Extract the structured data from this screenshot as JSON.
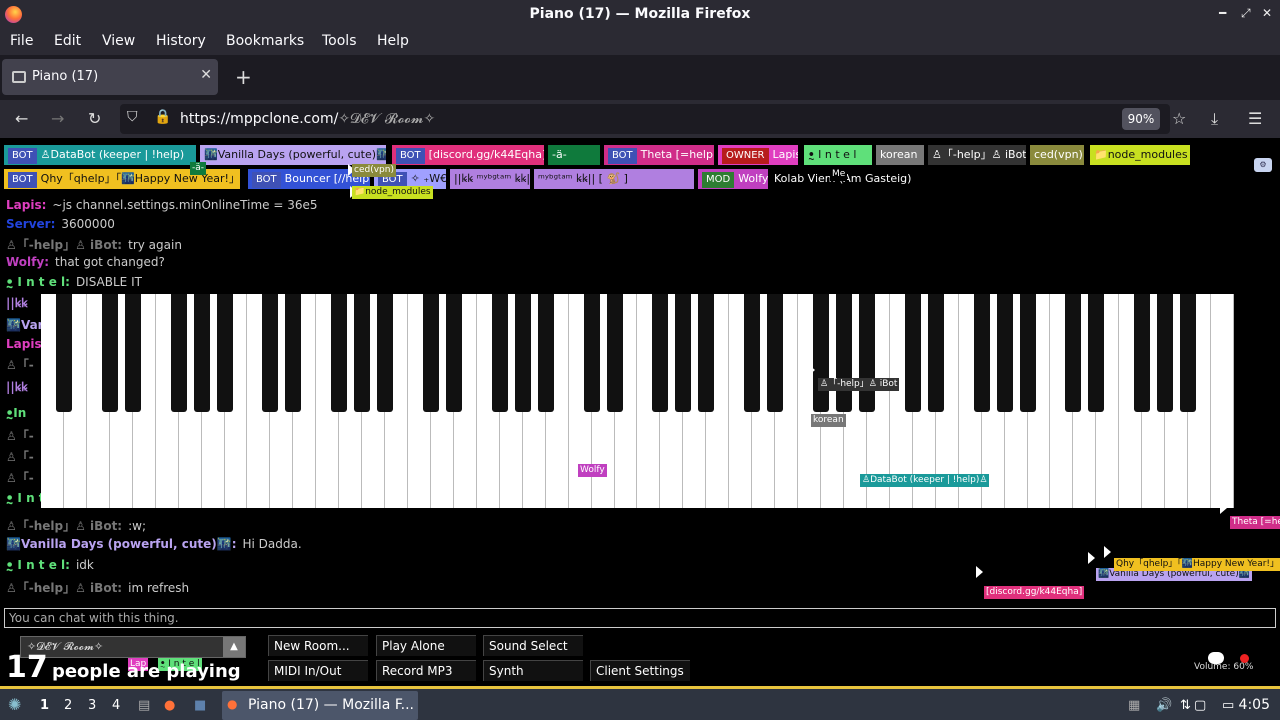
{
  "window": {
    "title": "Piano (17) — Mozilla Firefox"
  },
  "menu": [
    "File",
    "Edit",
    "View",
    "History",
    "Bookmarks",
    "Tools",
    "Help"
  ],
  "tab": {
    "title": "Piano (17)"
  },
  "nav": {
    "url_host": "https://mppclone.com/",
    "url_path": "✧𝓓𝓔𝓥 𝓡𝓸𝓸𝓶✧",
    "zoom": "90%"
  },
  "users_row1": [
    {
      "badge": "BOT",
      "name": "♙DataBot (keeper | !help)",
      "color": "#1a9a9a"
    },
    {
      "badge": "",
      "name": "🌃Vanilla Days (powerful, cute)🌃",
      "color": "#b9a3f0"
    },
    {
      "badge": "BOT",
      "name": "[discord.gg/k44Eqha]",
      "color": "#e0307c"
    },
    {
      "badge": "",
      "name": "-ä-",
      "color": "#0f7a3c"
    },
    {
      "badge": "BOT",
      "name": "Theta [=help]",
      "color": "#d02d89"
    },
    {
      "badge": "OWNER",
      "name": "Lapis",
      "color": "#e03ec0"
    },
    {
      "badge": "",
      "name": "ꔸ I n t e l",
      "color": "#5fe07a"
    },
    {
      "badge": "",
      "name": "korean",
      "color": "#777777"
    },
    {
      "badge": "",
      "name": "♙「-help」♙ iBot",
      "color": "#333333"
    },
    {
      "badge": "",
      "name": "ced(vpn)",
      "color": "#8a8a3c"
    },
    {
      "badge": "",
      "name": "📁node_modules",
      "color": "#c8e020"
    }
  ],
  "users_row2": [
    {
      "badge": "BOT",
      "name": "Qhy「qhelp」「🌃Happy New Year!」",
      "color": "#f0c020"
    },
    {
      "badge": "BOT",
      "name": "Bouncer [//help]",
      "color": "#3352d6"
    },
    {
      "badge": "BOT",
      "name": "✧ ₊W€...",
      "color": "#a0a0ff"
    },
    {
      "badge": "",
      "name": "||ꝃꝃ ᵐʸᵇᵍᵗᵃᵐ ꝃꝃ||",
      "color": "#b07fe0"
    },
    {
      "badge": "",
      "name": "ᵐʸᵇᵍᵗᵃᵐ ꝃꝃ|| [ 🐒 ]",
      "color": "#b07fe0"
    },
    {
      "badge": "MOD",
      "name": "Wolfy",
      "color": "#c040c0"
    },
    {
      "badge": "",
      "name": "Kolab Viem (Am Gasteig)",
      "color": "#000000"
    }
  ],
  "chat": [
    {
      "name": "Lapis:",
      "text": "~js channel.settings.minOnlineTime = 36e5",
      "color": "#e03ec0"
    },
    {
      "name": "Server:",
      "text": "3600000",
      "color": "#2244dd"
    },
    {
      "name": "♙「-help」♙ iBot:",
      "text": "try again",
      "color": "#777777"
    },
    {
      "name": "Wolfy:",
      "text": "that got changed?",
      "color": "#c040c0"
    },
    {
      "name": "ꔸ I n t e l:",
      "text": "DISABLE IT",
      "color": "#5fe07a"
    },
    {
      "name": "||ꝃꝃ",
      "text": "",
      "color": "#b07fe0"
    },
    {
      "name": "🌃Var",
      "text": "",
      "color": "#b9a3f0"
    },
    {
      "name": "Lapis",
      "text": "",
      "color": "#e03ec0"
    },
    {
      "name": "♙「-",
      "text": "",
      "color": "#777777"
    },
    {
      "name": "||ꝃꝃ",
      "text": "",
      "color": "#b07fe0"
    },
    {
      "name": "ꔸIn",
      "text": "",
      "color": "#5fe07a"
    },
    {
      "name": "♙「-",
      "text": "",
      "color": "#777777"
    },
    {
      "name": "♙「-",
      "text": "",
      "color": "#777777"
    },
    {
      "name": "♙「-",
      "text": "",
      "color": "#777777"
    },
    {
      "name": "ꔸ I n t e l:",
      "text": "",
      "color": "#5fe07a"
    },
    {
      "name": "♙「-help」♙ iBot:",
      "text": ":w;",
      "color": "#777777"
    },
    {
      "name": "🌃Vanilla Days (powerful, cute)🌃:",
      "text": "Hi Dadda.",
      "color": "#b9a3f0"
    },
    {
      "name": "ꔸ I n t e l:",
      "text": "idk",
      "color": "#5fe07a"
    },
    {
      "name": "♙「-help」♙ iBot:",
      "text": "im refresh",
      "color": "#777777"
    }
  ],
  "cursors": [
    {
      "label": "♙「-help」♙ iBot",
      "color": "#333333"
    },
    {
      "label": "korean",
      "color": "#777777"
    },
    {
      "label": "Wolfy",
      "color": "#c040c0"
    },
    {
      "label": "♙DataBot (keeper | !help)♙",
      "color": "#1a9a9a"
    },
    {
      "label": "Theta [=he",
      "color": "#d02d89"
    },
    {
      "label": "[discord.gg/k44Eqha]",
      "color": "#e0307c"
    },
    {
      "label": "🌃Vanilla Days (powerful, cute)🌃",
      "color": "#b9a3f0"
    },
    {
      "label": "Qhy「qhelp」「🌃Happy New Year!」",
      "color": "#f0c020"
    },
    {
      "label": "ced(vpn)",
      "color": "#8a8a3c"
    },
    {
      "label": "📁node_modules",
      "color": "#c8e020"
    },
    {
      "label": "Me",
      "color": "#000000"
    },
    {
      "label": "-ä-",
      "color": "#0f7a3c"
    },
    {
      "label": "Lap",
      "color": "#e03ec0"
    },
    {
      "label": "ꔸ I n t e l",
      "color": "#5fe07a"
    }
  ],
  "chat_placeholder": "You can chat with this thing.",
  "room": "✧𝓓𝓔𝓥 𝓡𝓸𝓸𝓶✧",
  "buttons": {
    "new_room": "New Room...",
    "play_alone": "Play Alone",
    "sound_select": "Sound Select",
    "midi": "MIDI In/Out",
    "record": "Record MP3",
    "synth": "Synth",
    "client_settings": "Client Settings"
  },
  "people": {
    "count": "17",
    "label": "people are playing"
  },
  "volume": "Volume: 60%",
  "taskbar": {
    "workspaces": [
      "1",
      "2",
      "3",
      "4"
    ],
    "app_title": "Piano (17) — Mozilla F...",
    "clock": "4:05"
  }
}
